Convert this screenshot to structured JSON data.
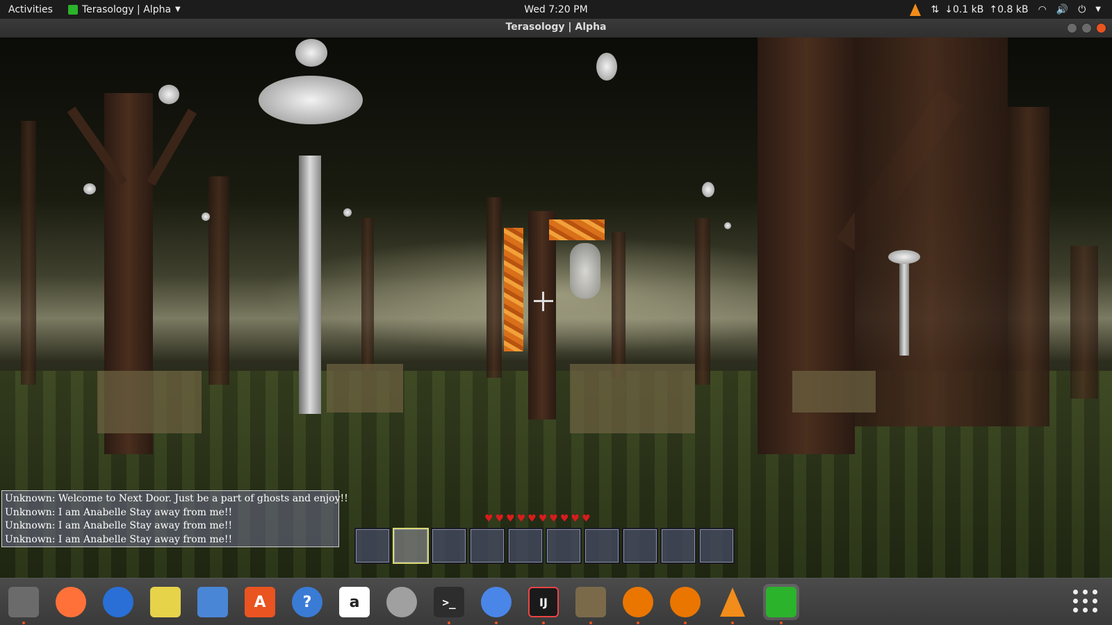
{
  "topbar": {
    "activities": "Activities",
    "app_menu": "Terasology | Alpha",
    "clock": "Wed  7:20 PM",
    "net_down": "↓0.1 kB",
    "net_up": "↑0.8 kB"
  },
  "window": {
    "title": "Terasology | Alpha"
  },
  "chat": {
    "messages": [
      "Unknown: Welcome to Next Door. Just be a part of ghosts and enjoy!!",
      "Unknown: I am Anabelle Stay away from me!!",
      "Unknown: I am Anabelle Stay away from me!!",
      "Unknown: I am Anabelle Stay away from me!!"
    ]
  },
  "hud": {
    "health_hearts": 10,
    "hotbar_slots": 10,
    "selected_slot": 2
  },
  "dock": {
    "items": [
      {
        "icon": "files-icon",
        "color": "#6b6b6b"
      },
      {
        "icon": "firefox-icon",
        "color": "#ff7139"
      },
      {
        "icon": "thunderbird-icon",
        "color": "#2a6fd6"
      },
      {
        "icon": "rhythmbox-icon",
        "color": "#e6d34a"
      },
      {
        "icon": "image-viewer-icon",
        "color": "#4a86d6"
      },
      {
        "icon": "software-center-icon",
        "color": "#e95420"
      },
      {
        "icon": "help-icon",
        "color": "#3a7bd5"
      },
      {
        "icon": "amazon-icon",
        "color": "#ffffff"
      },
      {
        "icon": "system-settings-icon",
        "color": "#a0a0a0"
      },
      {
        "icon": "terminal-icon",
        "color": "#2d2d2d"
      },
      {
        "icon": "chromium-icon",
        "color": "#4a86e8"
      },
      {
        "icon": "intellij-icon",
        "color": "#1a1a1a"
      },
      {
        "icon": "gimp-icon",
        "color": "#7a6a4a"
      },
      {
        "icon": "blender-icon",
        "color": "#ea7600"
      },
      {
        "icon": "blender-icon",
        "color": "#ea7600"
      },
      {
        "icon": "vlc-icon",
        "color": "#f28c1a"
      },
      {
        "icon": "terasology-icon",
        "color": "#2bb32b"
      }
    ],
    "amazon_glyph": "a",
    "terminal_glyph": ">_",
    "intellij_glyph": "IJ",
    "help_glyph": "?",
    "software_glyph": "A"
  }
}
